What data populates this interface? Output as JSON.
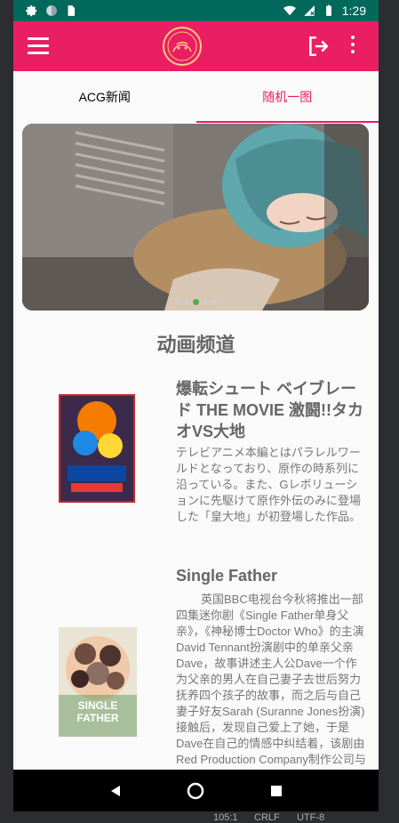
{
  "status_bar": {
    "time": "1:29",
    "icons": [
      "gear-icon",
      "circle-icon",
      "sd-card-icon",
      "wifi-icon",
      "signal-icon",
      "battery-icon"
    ]
  },
  "app_bar": {
    "menu_icon": "hamburger-icon",
    "logo": "anime-logo",
    "logout_icon": "logout-icon",
    "more_icon": "more-vert-icon",
    "accent_color": "#e91e63"
  },
  "tabs": [
    {
      "label": "ACG新闻",
      "active": false
    },
    {
      "label": "随机一图",
      "active": true
    }
  ],
  "banner": {
    "image": "anime-illustration-blue-haired-girl",
    "dot_count": 5,
    "active_dot": 2
  },
  "section": {
    "title": "动画频道"
  },
  "items": [
    {
      "title": "爆転シュート ベイブレード THE MOVIE 激闘!!タカオVS大地",
      "description": "テレビアニメ本編とはパラレルワールドとなっており、原作の時系列に沿っている。また、Gレボリューションに先駆けて原作外伝のみに登場した「皇大地」が初登場した作品。",
      "poster": "beyblade-movie-poster"
    },
    {
      "title": "Single Father",
      "description": "英国BBC电视台今秋将推出一部四集迷你剧《Single Father单身父亲》，《神秘博士Doctor Who》的主演David Tennant扮演剧中的单亲父亲Dave，故事讲述主人公Dave一个作为父亲的男人在自己妻子去世后努力抚养四个孩子的故事，而之后与自己妻子好友Sarah (Suranne Jones扮演)接触后，发现自己爱上了她，于是Dave在自己的情感中纠结着，该剧由Red Production Company制作公司与",
      "poster": "single-father-poster",
      "poster_text": "SINGLE FATHER"
    }
  ],
  "nav_bar": {
    "back_icon": "back-triangle-icon",
    "home_icon": "home-circle-icon",
    "recents_icon": "recents-square-icon"
  },
  "ide_status": {
    "position": "105:1",
    "line_ending": "CRLF",
    "encoding": "UTF-8"
  }
}
